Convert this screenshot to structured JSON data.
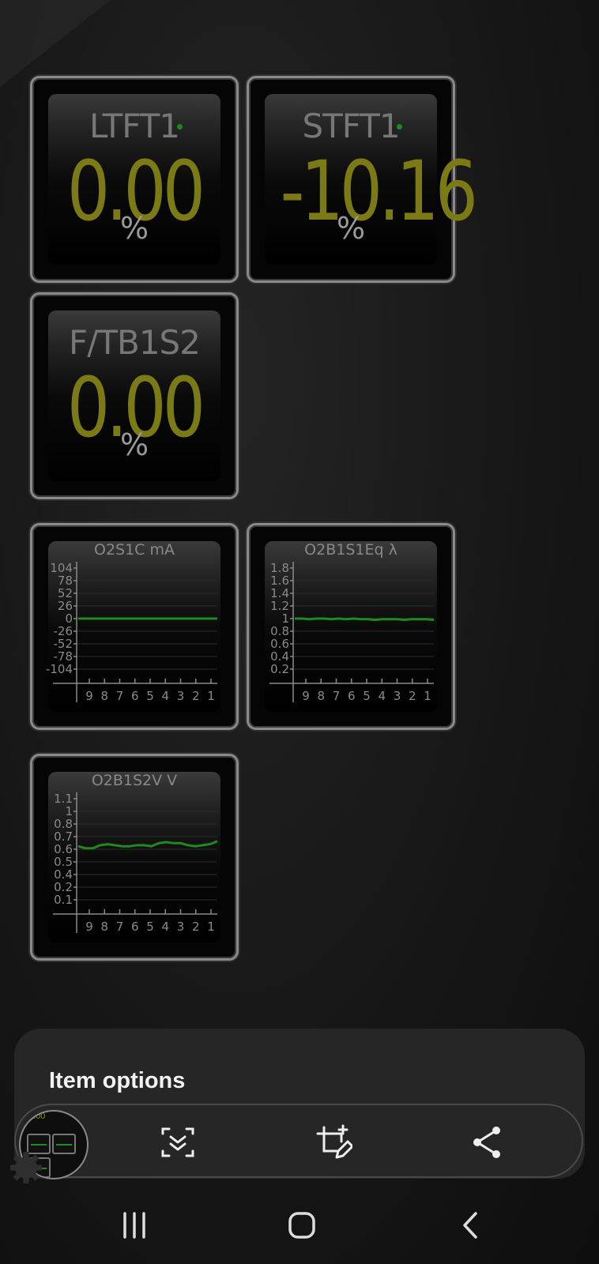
{
  "gauges": {
    "ltft": {
      "label": "LTFT1",
      "value": "0.00",
      "unit": "%"
    },
    "stft": {
      "label": "STFT1",
      "value": "-10.16",
      "unit": "%"
    },
    "ftb": {
      "label": "F/TB1S2",
      "value": "0.00",
      "unit": "%"
    }
  },
  "chart_data": [
    {
      "type": "line",
      "title": "O2S1C  mA",
      "y_ticks": [
        "104",
        "78",
        "52",
        "26",
        "0",
        "-26",
        "-52",
        "-78",
        "-104"
      ],
      "x_ticks": [
        "9",
        "8",
        "7",
        "6",
        "5",
        "4",
        "3",
        "2",
        "1"
      ],
      "ylim": [
        -104,
        104
      ],
      "values": [
        0,
        0,
        0,
        0,
        0,
        0,
        0,
        0,
        0,
        0,
        0,
        0,
        0,
        0,
        0,
        0,
        0,
        0,
        0,
        0
      ],
      "color": "#1f8a1f"
    },
    {
      "type": "line",
      "title": "O2B1S1Eq  λ",
      "y_ticks": [
        "1.8",
        "1.6",
        "1.4",
        "1.2",
        "1",
        "0.8",
        "0.6",
        "0.4",
        "0.2"
      ],
      "x_ticks": [
        "9",
        "8",
        "7",
        "6",
        "5",
        "4",
        "3",
        "2",
        "1"
      ],
      "ylim": [
        0,
        2
      ],
      "values": [
        1.0,
        1.0,
        0.99,
        1.0,
        1.0,
        0.99,
        1.0,
        0.99,
        1.0,
        0.99,
        0.99,
        0.98,
        0.99,
        0.99,
        0.99,
        0.98,
        0.99,
        0.99,
        0.99,
        0.98
      ],
      "color": "#1f8a1f"
    },
    {
      "type": "line",
      "title": "O2B1S2V  V",
      "y_ticks": [
        "1.1",
        "1",
        "0.8",
        "0.7",
        "0.6",
        "0.5",
        "0.4",
        "0.2",
        "0.1"
      ],
      "x_ticks": [
        "9",
        "8",
        "7",
        "6",
        "5",
        "4",
        "3",
        "2",
        "1"
      ],
      "ylim": [
        0,
        1.2
      ],
      "values": [
        0.63,
        0.61,
        0.61,
        0.64,
        0.65,
        0.64,
        0.63,
        0.63,
        0.64,
        0.64,
        0.63,
        0.66,
        0.67,
        0.66,
        0.66,
        0.64,
        0.63,
        0.64,
        0.65,
        0.68
      ],
      "color": "#1f8a1f"
    }
  ],
  "sheet": {
    "title": "Item options"
  },
  "thumbnail": {
    "text": "0.00"
  },
  "colors": {
    "value_text": "#7b7a14",
    "series": "#1f8a1f",
    "sheet_bg": "#262626"
  }
}
